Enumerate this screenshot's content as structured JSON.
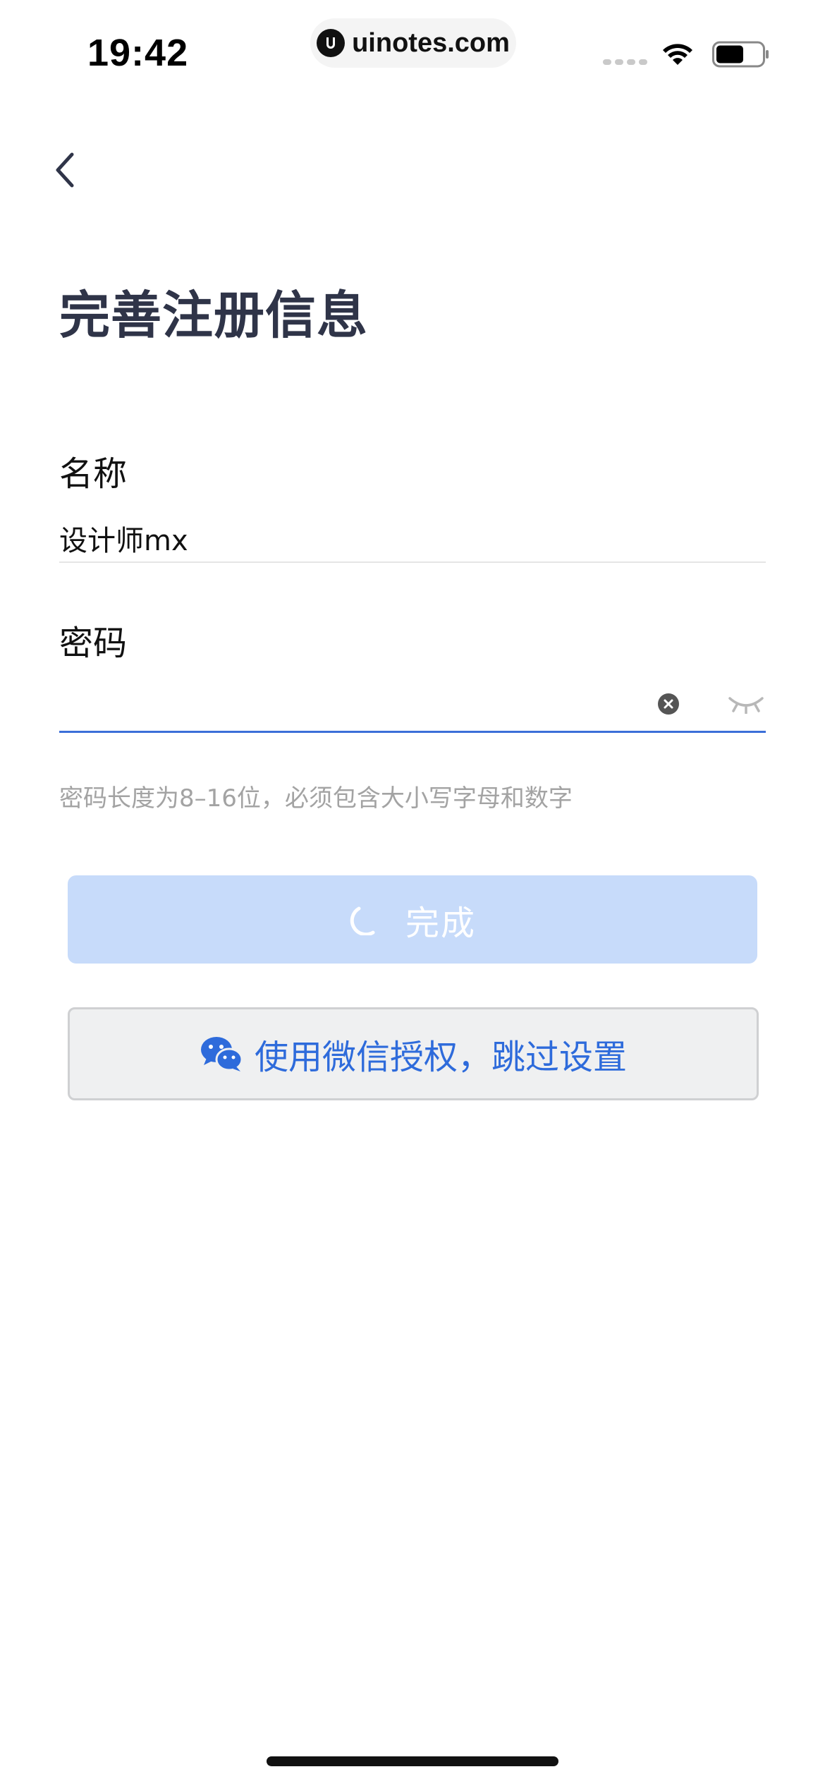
{
  "status_bar": {
    "time": "19:42",
    "url": "uinotes.com"
  },
  "page": {
    "title": "完善注册信息"
  },
  "form": {
    "name_label": "名称",
    "name_value": "设计师mx",
    "password_label": "密码",
    "password_value": "",
    "password_hint": "密码长度为8–16位，必须包含大小写字母和数字"
  },
  "buttons": {
    "submit_label": "完成",
    "wechat_label": "使用微信授权，跳过设置"
  },
  "colors": {
    "accent": "#3b6fd8",
    "submit_bg_disabled": "#c7dbfa",
    "title": "#2f3448",
    "hint": "#a3a3a3"
  },
  "icons": {
    "back": "chevron-left-icon",
    "clear": "clear-circle-icon",
    "visibility": "eye-closed-icon",
    "loading": "spinner-icon",
    "wechat": "wechat-icon"
  }
}
